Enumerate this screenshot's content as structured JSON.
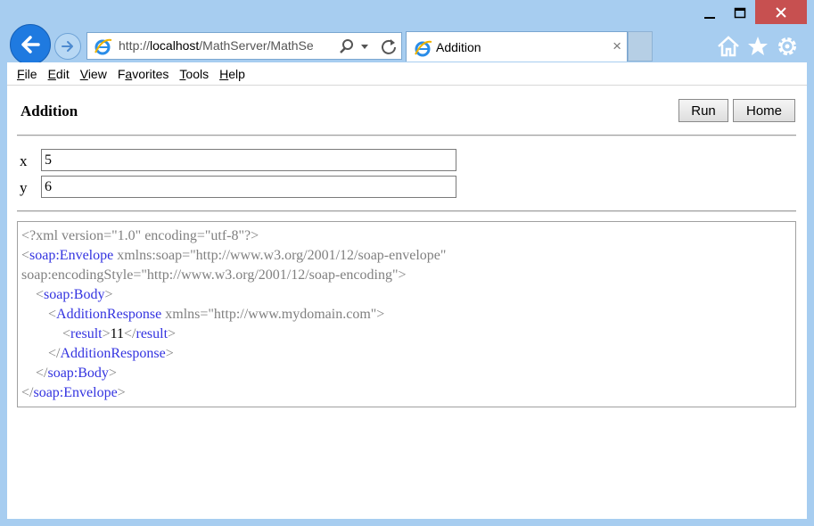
{
  "window": {
    "minimize": "—",
    "maximize": "☐",
    "close": "✕"
  },
  "address": {
    "prefix": "http://",
    "host": "localhost",
    "path": "/MathServer/MathSe"
  },
  "tab": {
    "label": "Addition",
    "close": "×"
  },
  "menu": [
    {
      "key": "F",
      "rest": "ile"
    },
    {
      "key": "E",
      "rest": "dit"
    },
    {
      "key": "V",
      "rest": "iew"
    },
    {
      "pre": "F",
      "key": "a",
      "rest": "vorites"
    },
    {
      "key": "T",
      "rest": "ools"
    },
    {
      "key": "H",
      "rest": "elp"
    }
  ],
  "page": {
    "title": "Addition",
    "run_label": "Run",
    "home_label": "Home",
    "x_label": "x",
    "x_value": "5",
    "y_label": "y",
    "y_value": "6"
  },
  "xml": {
    "decl": "<?xml version=\"1.0\" encoding=\"utf-8\"?>",
    "lt": "<",
    "gt": ">",
    "lt_slash": "</",
    "envelope_tag": "soap:Envelope",
    "envelope_attr1": " xmlns:soap=\"http://www.w3.org/2001/12/soap-envelope\"",
    "envelope_attr2": "soap:encodingStyle=\"http://www.w3.org/2001/12/soap-encoding\">",
    "body_tag": "soap:Body",
    "response_tag": "AdditionResponse",
    "response_attr": " xmlns=\"http://www.mydomain.com\"",
    "result_tag": "result",
    "result_value": "11"
  }
}
